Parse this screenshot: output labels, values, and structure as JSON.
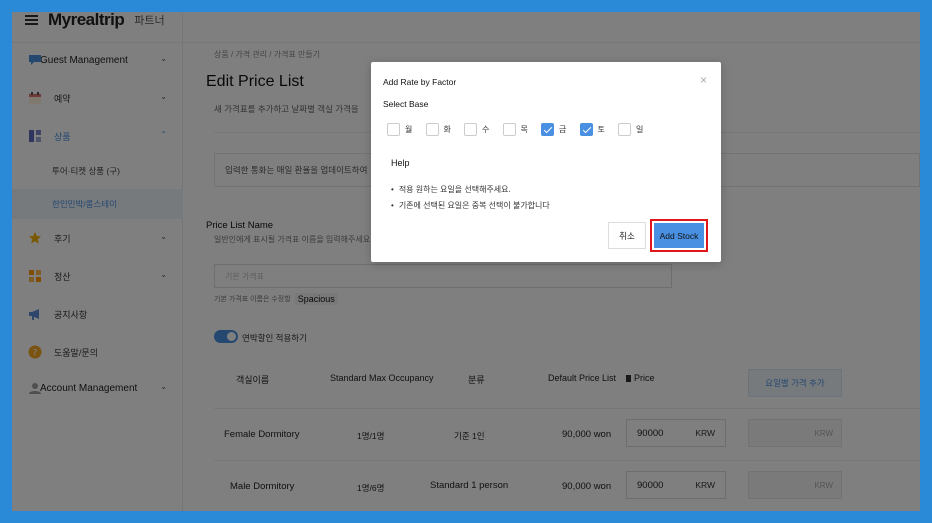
{
  "brand": {
    "logo": "Myrealtrip",
    "partner": "파트너"
  },
  "sidebar": {
    "items": [
      {
        "label": "Guest Management",
        "icon": "chat-icon"
      },
      {
        "label": "예약",
        "icon": "calendar-icon"
      },
      {
        "label": "상품",
        "icon": "grid-icon"
      },
      {
        "label": "투어·티켓 상품 (구)"
      },
      {
        "label": "한인민박/룸스테이"
      },
      {
        "label": "후기",
        "icon": "star-icon"
      },
      {
        "label": "정산",
        "icon": "tiles-icon"
      },
      {
        "label": "공지사항",
        "icon": "megaphone-icon"
      },
      {
        "label": "도움말/문의",
        "icon": "help-icon"
      },
      {
        "label": "Account Management",
        "icon": "user-icon"
      }
    ]
  },
  "main": {
    "breadcrumb": "상품 / 가격 관리 / 가격표 만들기",
    "title": "Edit Price List",
    "subtitle": "새 가격표를 추가하고 날짜별 객실 가격을",
    "info": "입력한 통화는 매일 환율을 업데이트하여",
    "price_list_label": "Price List Name",
    "price_list_help": "일반인에게 표시될 가격표 이름을 입력해주세요.",
    "price_list_placeholder": "기본 가격표",
    "price_list_note": "기본 가격표 이름은 수정할",
    "price_list_note_tag": "Spacious",
    "toggle_label": "연박할인 적용하기",
    "table": {
      "headers": [
        "객실이름",
        "Standard Max Occupancy",
        "분류",
        "Default Price List",
        "Price"
      ],
      "weekday_button": "요일별 가격 추가",
      "rows": [
        {
          "name": "Female Dormitory",
          "occupancy": "1명/1명",
          "type": "기준 1인",
          "default_price": "90,000 won",
          "price": "90000",
          "currency": "KRW",
          "weekday_currency": "KRW"
        },
        {
          "name": "Male Dormitory",
          "occupancy": "1명/6명",
          "type": "Standard 1 person",
          "default_price": "90,000 won",
          "price": "90000",
          "currency": "KRW",
          "weekday_currency": "KRW"
        }
      ]
    }
  },
  "modal": {
    "title": "Add Rate by Factor",
    "close": "×",
    "select_base": "Select Base",
    "days": [
      {
        "label": "월",
        "checked": false
      },
      {
        "label": "화",
        "checked": false
      },
      {
        "label": "수",
        "checked": false
      },
      {
        "label": "목",
        "checked": false
      },
      {
        "label": "금",
        "checked": true
      },
      {
        "label": "토",
        "checked": true
      },
      {
        "label": "일",
        "checked": false
      }
    ],
    "help_title": "Help",
    "help_items": [
      "적용 원하는 요일을 선택해주세요.",
      "기존에 선택된 요일은 중복 선택이 불가합니다"
    ],
    "cancel": "취소",
    "submit": "Add Stock"
  },
  "colors": {
    "accent": "#4a90e2",
    "highlight": "#e0161b",
    "frame": "#2a8ad8"
  }
}
